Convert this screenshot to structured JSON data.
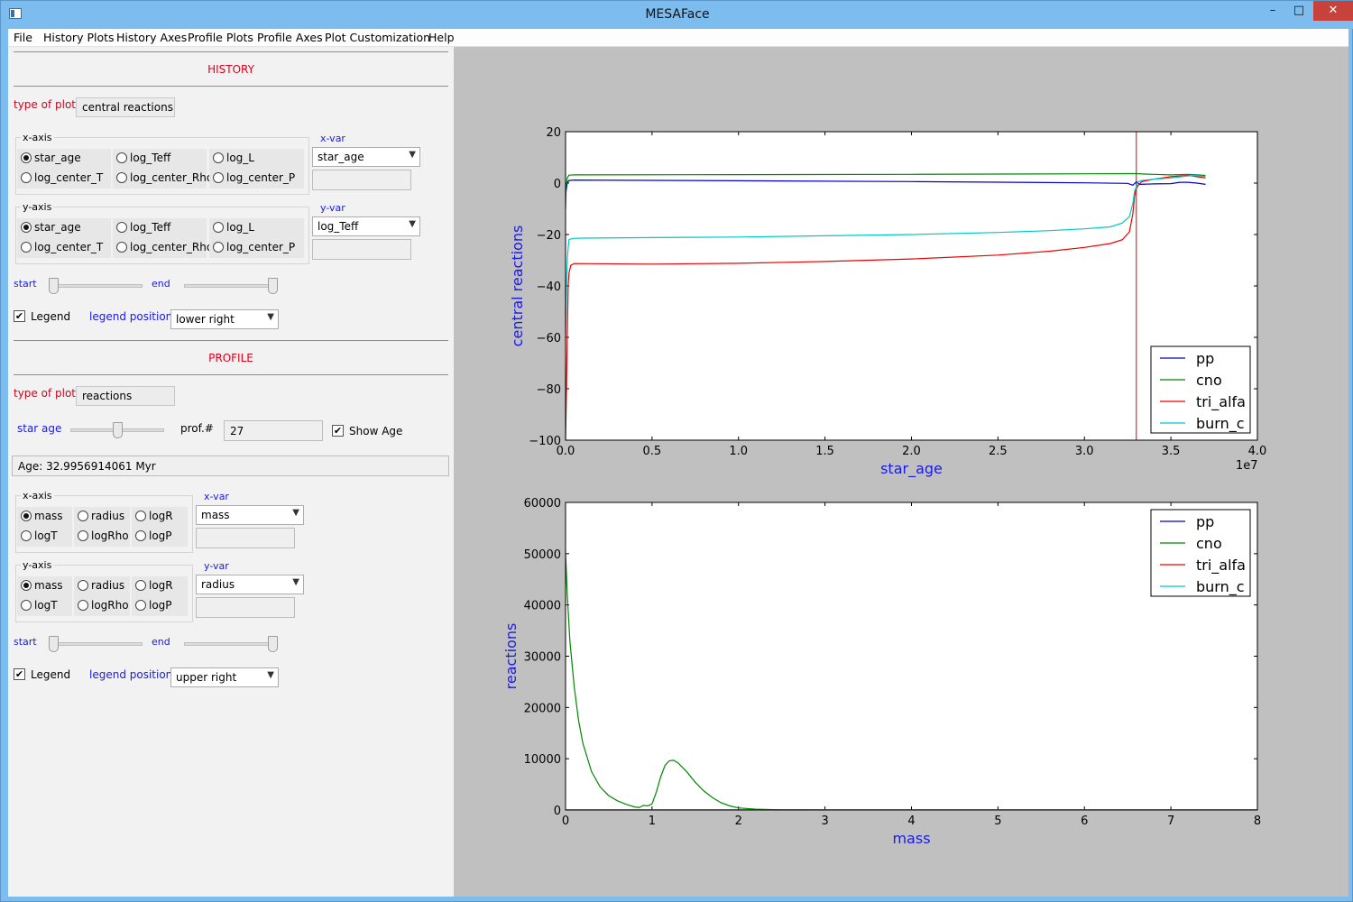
{
  "window": {
    "title": "MESAFace",
    "minimize": "–",
    "maximize": "□",
    "close": "✕"
  },
  "menu": [
    "File",
    "History Plots",
    "History Axes",
    "Profile Plots",
    "Profile Axes",
    "Plot Customization",
    "Help"
  ],
  "history": {
    "title": "HISTORY",
    "type_label": "type of plot:",
    "type_value": "central reactions",
    "xaxis": {
      "group_title": "x-axis",
      "options": [
        "star_age",
        "log_Teff",
        "log_L",
        "log_center_T",
        "log_center_Rho",
        "log_center_P"
      ],
      "selected": "star_age",
      "var_label": "x-var",
      "var_value": "star_age",
      "var_text": ""
    },
    "yaxis": {
      "group_title": "y-axis",
      "options": [
        "star_age",
        "log_Teff",
        "log_L",
        "log_center_T",
        "log_center_Rho",
        "log_center_P"
      ],
      "selected": "star_age",
      "var_label": "y-var",
      "var_value": "log_Teff",
      "var_text": ""
    },
    "start_label": "start",
    "end_label": "end",
    "start_value": 0,
    "end_value": 1,
    "legend_label": "Legend",
    "legend_checked": true,
    "legend_position_label": "legend position",
    "legend_position": "lower right"
  },
  "profile": {
    "title": "PROFILE",
    "type_label": "type of plot:",
    "type_value": "reactions",
    "star_age_label": "star age",
    "star_age_slider": 0.45,
    "prof_label": "prof.#",
    "prof_value": "27",
    "show_age_label": "Show Age",
    "show_age_checked": true,
    "age_text": "Age: 32.9956914061  Myr",
    "xaxis": {
      "group_title": "x-axis",
      "options": [
        "mass",
        "radius",
        "logR",
        "logT",
        "logRho",
        "logP"
      ],
      "selected": "mass",
      "var_label": "x-var",
      "var_value": "mass",
      "var_text": ""
    },
    "yaxis": {
      "group_title": "y-axis",
      "options": [
        "mass",
        "radius",
        "logR",
        "logT",
        "logRho",
        "logP"
      ],
      "selected": "mass",
      "var_label": "y-var",
      "var_value": "radius",
      "var_text": ""
    },
    "start_label": "start",
    "end_label": "end",
    "start_value": 0,
    "end_value": 1,
    "legend_label": "Legend",
    "legend_checked": true,
    "legend_position_label": "legend position",
    "legend_position": "upper right"
  },
  "chart_data": [
    {
      "type": "line",
      "xlabel": "star_age",
      "ylabel": "central reactions",
      "xlim": [
        0,
        4.0
      ],
      "ylim": [
        -100,
        20
      ],
      "xticks": [
        "0.0",
        "0.5",
        "1.0",
        "1.5",
        "2.0",
        "2.5",
        "3.0",
        "3.5",
        "4.0"
      ],
      "yticks": [
        "20",
        "0",
        "−20",
        "−40",
        "−60",
        "−80",
        "−100"
      ],
      "offset_text": "1e7",
      "legend_position": "lower right",
      "marker_x": 3.3,
      "series": [
        {
          "name": "pp",
          "color": "#0000cc",
          "x": [
            0,
            0.003,
            0.01,
            0.02,
            0.05,
            1.0,
            2.0,
            3.0,
            3.25,
            3.28,
            3.3,
            3.32,
            3.4,
            3.5,
            3.55,
            3.6,
            3.65,
            3.7
          ],
          "y": [
            -5,
            -3,
            0,
            1,
            1.2,
            0.9,
            0.6,
            0.1,
            -0.1,
            -0.8,
            0.5,
            -0.5,
            -0.3,
            -0.2,
            0.3,
            0.3,
            0,
            -0.5
          ]
        },
        {
          "name": "cno",
          "color": "#008800",
          "x": [
            0,
            0.003,
            0.01,
            0.02,
            0.05,
            1.0,
            2.0,
            3.0,
            3.25,
            3.3,
            3.35,
            3.4,
            3.5,
            3.55,
            3.6,
            3.65,
            3.7
          ],
          "y": [
            -10,
            -2,
            2,
            3.1,
            3.2,
            3.3,
            3.4,
            3.6,
            3.7,
            3.7,
            3.5,
            3.4,
            3.2,
            3.3,
            3.4,
            3.2,
            3.0
          ]
        },
        {
          "name": "tri_alfa",
          "color": "#ee0000",
          "x": [
            0,
            0.005,
            0.01,
            0.015,
            0.02,
            0.03,
            0.05,
            0.5,
            1.0,
            1.5,
            2.0,
            2.5,
            2.8,
            3.0,
            3.15,
            3.22,
            3.26,
            3.28,
            3.29,
            3.3,
            3.31,
            3.33,
            3.4,
            3.5,
            3.6,
            3.65,
            3.7
          ],
          "y": [
            -100,
            -80,
            -60,
            -40,
            -35,
            -32,
            -31.3,
            -31.5,
            -31.2,
            -30.5,
            -29.5,
            -28,
            -26.5,
            -25,
            -23.5,
            -22,
            -19,
            -12,
            -5,
            -2,
            -1,
            0.5,
            1.5,
            2.5,
            3,
            2.5,
            2.0
          ]
        },
        {
          "name": "burn_c",
          "color": "#00c8c8",
          "x": [
            0,
            0.005,
            0.01,
            0.015,
            0.02,
            0.04,
            0.1,
            0.5,
            1.0,
            1.5,
            2.0,
            2.5,
            2.8,
            3.0,
            3.15,
            3.22,
            3.26,
            3.28,
            3.29,
            3.3,
            3.31,
            3.33,
            3.4,
            3.5,
            3.6,
            3.65,
            3.7
          ],
          "y": [
            -60,
            -40,
            -30,
            -25,
            -22,
            -21.5,
            -21.4,
            -21.2,
            -21,
            -20.5,
            -20,
            -19.2,
            -18.5,
            -17.8,
            -17,
            -15.5,
            -13,
            -8,
            -3,
            -1.5,
            0.5,
            1,
            1.5,
            2,
            2.8,
            2.9,
            2.5
          ]
        }
      ]
    },
    {
      "type": "line",
      "xlabel": "mass",
      "ylabel": "reactions",
      "xlim": [
        0,
        8
      ],
      "ylim": [
        0,
        60000
      ],
      "xticks": [
        "0",
        "1",
        "2",
        "3",
        "4",
        "5",
        "6",
        "7",
        "8"
      ],
      "yticks": [
        "60000",
        "50000",
        "40000",
        "30000",
        "20000",
        "10000",
        "0"
      ],
      "legend_position": "upper right",
      "series": [
        {
          "name": "pp",
          "color": "#0000cc",
          "x": [
            0,
            8
          ],
          "y": [
            0,
            0
          ]
        },
        {
          "name": "cno",
          "color": "#008800",
          "x": [
            0,
            0.02,
            0.05,
            0.1,
            0.15,
            0.2,
            0.3,
            0.4,
            0.5,
            0.6,
            0.7,
            0.8,
            0.85,
            0.88,
            0.9,
            0.95,
            1.0,
            1.05,
            1.1,
            1.15,
            1.2,
            1.25,
            1.3,
            1.4,
            1.5,
            1.6,
            1.7,
            1.8,
            1.9,
            2.0,
            2.2,
            2.5,
            3.0,
            8.0
          ],
          "y": [
            50000,
            42000,
            33000,
            24000,
            17500,
            13000,
            7500,
            4500,
            2800,
            1800,
            1100,
            600,
            500,
            700,
            900,
            800,
            1200,
            3500,
            6500,
            8700,
            9600,
            9700,
            9200,
            7500,
            5400,
            3700,
            2400,
            1400,
            800,
            400,
            150,
            40,
            0,
            0
          ]
        },
        {
          "name": "tri_alfa",
          "color": "#ee0000",
          "x": [
            0,
            8
          ],
          "y": [
            0,
            0
          ]
        },
        {
          "name": "burn_c",
          "color": "#00c8c8",
          "x": [
            0,
            8
          ],
          "y": [
            0,
            0
          ]
        }
      ]
    }
  ]
}
